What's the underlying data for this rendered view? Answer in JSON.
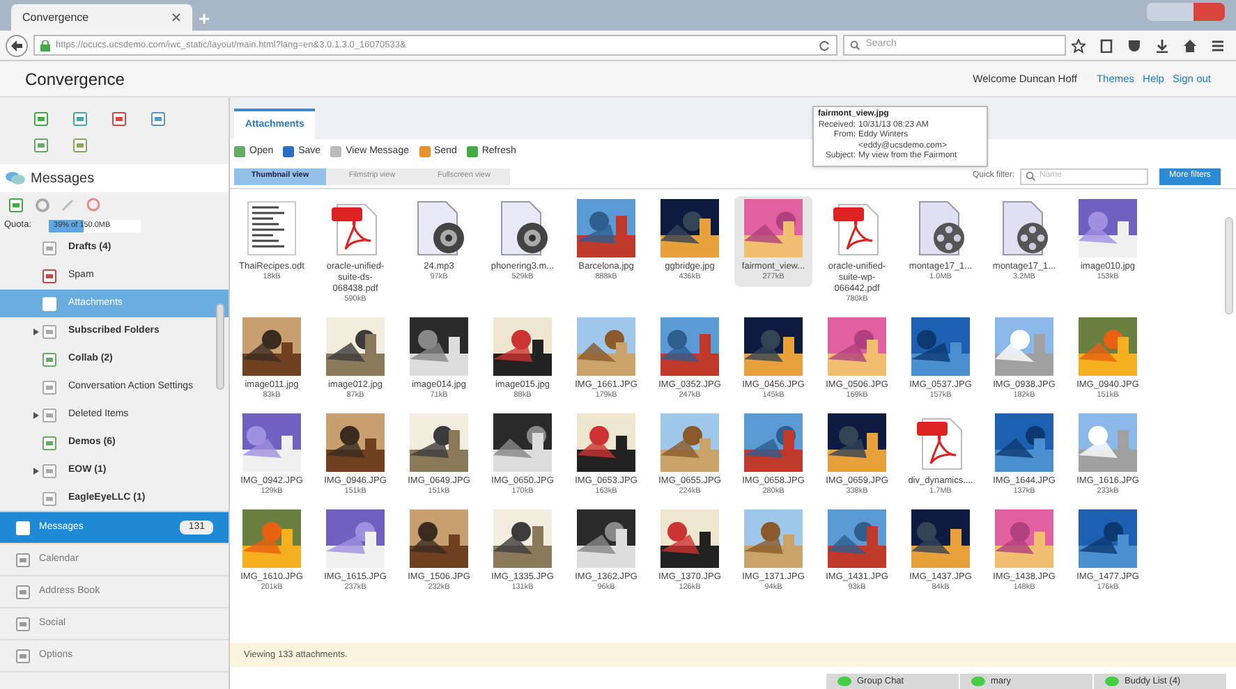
{
  "browser": {
    "tab": "Convergence",
    "url": "https://ocucs.ucsdemo.com/iwc_static/layout/main.html?lang=en&3.0.1.3.0_16070533&",
    "search_placeholder": "Search"
  },
  "header": {
    "title": "Convergence",
    "welcome": "Welcome Duncan Hoff",
    "links": [
      "Themes",
      "Help",
      "Sign out"
    ]
  },
  "sidebar": {
    "title": "Messages",
    "quota_label": "Quota:",
    "quota": {
      "level": 0.39,
      "reading": "39% of 150.0MB"
    },
    "folders": [
      {
        "name": "Drafts (4)",
        "bold": true,
        "collapsed": false,
        "selected": false
      },
      {
        "name": "Spam",
        "bold": false,
        "collapsed": false,
        "selected": false
      },
      {
        "name": "Attachments",
        "bold": false,
        "collapsed": false,
        "selected": true
      },
      {
        "name": "Subscribed Folders",
        "bold": true,
        "collapsed": true,
        "selected": false
      },
      {
        "name": "Collab (2)",
        "bold": true,
        "collapsed": false,
        "selected": false
      },
      {
        "name": "Conversation Action Settings",
        "bold": false,
        "collapsed": false,
        "selected": false
      },
      {
        "name": "Deleted Items",
        "bold": false,
        "collapsed": true,
        "selected": false
      },
      {
        "name": "Demos (6)",
        "bold": true,
        "collapsed": false,
        "selected": false
      },
      {
        "name": "EOW (1)",
        "bold": true,
        "collapsed": true,
        "selected": false
      },
      {
        "name": "EagleEyeLLC (1)",
        "bold": true,
        "collapsed": false,
        "selected": false
      }
    ],
    "nav": [
      {
        "label": "Messages",
        "count": "131",
        "selected": true
      },
      {
        "label": "Calendar",
        "selected": false
      },
      {
        "label": "Address Book",
        "selected": false
      },
      {
        "label": "Social",
        "selected": false
      },
      {
        "label": "Options",
        "selected": false
      }
    ]
  },
  "content": {
    "tab": "Attachments",
    "toolbar": [
      "Open",
      "Save",
      "View Message",
      "Send",
      "Refresh"
    ],
    "views": [
      {
        "label": "Thumbnail view",
        "selected": true
      },
      {
        "label": "Filmstrip view",
        "selected": false
      },
      {
        "label": "Fullscreen view",
        "selected": false
      }
    ],
    "filter_label": "Quick filter:",
    "filter_placeholder": "Name",
    "more_filters": "More filters",
    "items": [
      {
        "name": "ThaiRecipes.odt",
        "size": "18kB",
        "kind": "doc",
        "selected": false
      },
      {
        "name": "oracle-unified-suite-ds-068438.pdf",
        "size": "590kB",
        "kind": "pdf",
        "selected": false
      },
      {
        "name": "24.mp3",
        "size": "97kB",
        "kind": "audio",
        "selected": false
      },
      {
        "name": "phonering3.m...",
        "size": "529kB",
        "kind": "audio",
        "selected": false
      },
      {
        "name": "Barcelona.jpg",
        "size": "888kB",
        "kind": "picture",
        "selected": false
      },
      {
        "name": "ggbridge.jpg",
        "size": "436kB",
        "kind": "picture",
        "selected": false
      },
      {
        "name": "fairmont_view...",
        "size": "277kB",
        "kind": "picture",
        "selected": true
      },
      {
        "name": "oracle-unified-suite-wp-066442.pdf",
        "size": "780kB",
        "kind": "pdf",
        "selected": false
      },
      {
        "name": "montage17_1...",
        "size": "1.0MB",
        "kind": "video",
        "selected": false
      },
      {
        "name": "montage17_1...",
        "size": "3.2MB",
        "kind": "video",
        "selected": false
      },
      {
        "name": "image010.jpg",
        "size": "153kB",
        "kind": "picture",
        "selected": false
      },
      {
        "name": "image011.jpg",
        "size": "83kB",
        "kind": "picture",
        "selected": false
      },
      {
        "name": "image012.jpg",
        "size": "87kB",
        "kind": "picture",
        "selected": false
      },
      {
        "name": "image014.jpg",
        "size": "71kB",
        "kind": "picture",
        "selected": false
      },
      {
        "name": "image015.jpg",
        "size": "88kB",
        "kind": "picture",
        "selected": false
      },
      {
        "name": "IMG_1661.JPG",
        "size": "179kB",
        "kind": "picture",
        "selected": false
      },
      {
        "name": "IMG_0352.JPG",
        "size": "247kB",
        "kind": "picture",
        "selected": false
      },
      {
        "name": "IMG_0456.JPG",
        "size": "145kB",
        "kind": "picture",
        "selected": false
      },
      {
        "name": "IMG_0506.JPG",
        "size": "169kB",
        "kind": "picture",
        "selected": false
      },
      {
        "name": "IMG_0537.JPG",
        "size": "157kB",
        "kind": "picture",
        "selected": false
      },
      {
        "name": "IMG_0938.JPG",
        "size": "182kB",
        "kind": "picture",
        "selected": false
      },
      {
        "name": "IMG_0940.JPG",
        "size": "151kB",
        "kind": "picture",
        "selected": false
      },
      {
        "name": "IMG_0942.JPG",
        "size": "129kB",
        "kind": "picture",
        "selected": false
      },
      {
        "name": "IMG_0946.JPG",
        "size": "151kB",
        "kind": "picture",
        "selected": false
      },
      {
        "name": "IMG_0649.JPG",
        "size": "151kB",
        "kind": "picture",
        "selected": false
      },
      {
        "name": "IMG_0650.JPG",
        "size": "170kB",
        "kind": "picture",
        "selected": false
      },
      {
        "name": "IMG_0653.JPG",
        "size": "163kB",
        "kind": "picture",
        "selected": false
      },
      {
        "name": "IMG_0655.JPG",
        "size": "224kB",
        "kind": "picture",
        "selected": false
      },
      {
        "name": "IMG_0658.JPG",
        "size": "280kB",
        "kind": "picture",
        "selected": false
      },
      {
        "name": "IMG_0659.JPG",
        "size": "338kB",
        "kind": "picture",
        "selected": false
      },
      {
        "name": "div_dynamics....",
        "size": "1.7MB",
        "kind": "pdf",
        "selected": false
      },
      {
        "name": "IMG_1644.JPG",
        "size": "137kB",
        "kind": "picture",
        "selected": false
      },
      {
        "name": "IMG_1616.JPG",
        "size": "233kB",
        "kind": "picture",
        "selected": false
      },
      {
        "name": "IMG_1610.JPG",
        "size": "201kB",
        "kind": "picture",
        "selected": false
      },
      {
        "name": "IMG_1615.JPG",
        "size": "237kB",
        "kind": "picture",
        "selected": false
      },
      {
        "name": "IMG_1506.JPG",
        "size": "232kB",
        "kind": "picture",
        "selected": false
      },
      {
        "name": "IMG_1335.JPG",
        "size": "131kB",
        "kind": "picture",
        "selected": false
      },
      {
        "name": "IMG_1362.JPG",
        "size": "96kB",
        "kind": "picture",
        "selected": false
      },
      {
        "name": "IMG_1370.JPG",
        "size": "126kB",
        "kind": "picture",
        "selected": false
      },
      {
        "name": "IMG_1371.JPG",
        "size": "94kB",
        "kind": "picture",
        "selected": false
      },
      {
        "name": "IMG_1431.JPG",
        "size": "93kB",
        "kind": "picture",
        "selected": false
      },
      {
        "name": "IMG_1437.JPG",
        "size": "84kB",
        "kind": "picture",
        "selected": false
      },
      {
        "name": "IMG_1438.JPG",
        "size": "148kB",
        "kind": "picture",
        "selected": false
      },
      {
        "name": "IMG_1477.JPG",
        "size": "176kB",
        "kind": "picture",
        "selected": false
      }
    ],
    "status": "Viewing 133 attachments.",
    "tooltip": {
      "title": "fairmont_view.jpg",
      "rows": [
        {
          "label": "Received:",
          "value": "10/31/13 08:23 AM"
        },
        {
          "label": "From:",
          "value": "Eddy Winters <eddy@ucsdemo.com>"
        },
        {
          "label": "Subject:",
          "value": "My view from the Fairmont"
        }
      ]
    }
  },
  "chat": [
    {
      "label": "Group Chat"
    },
    {
      "label": "mary"
    },
    {
      "label": "Buddy List (4)"
    }
  ]
}
